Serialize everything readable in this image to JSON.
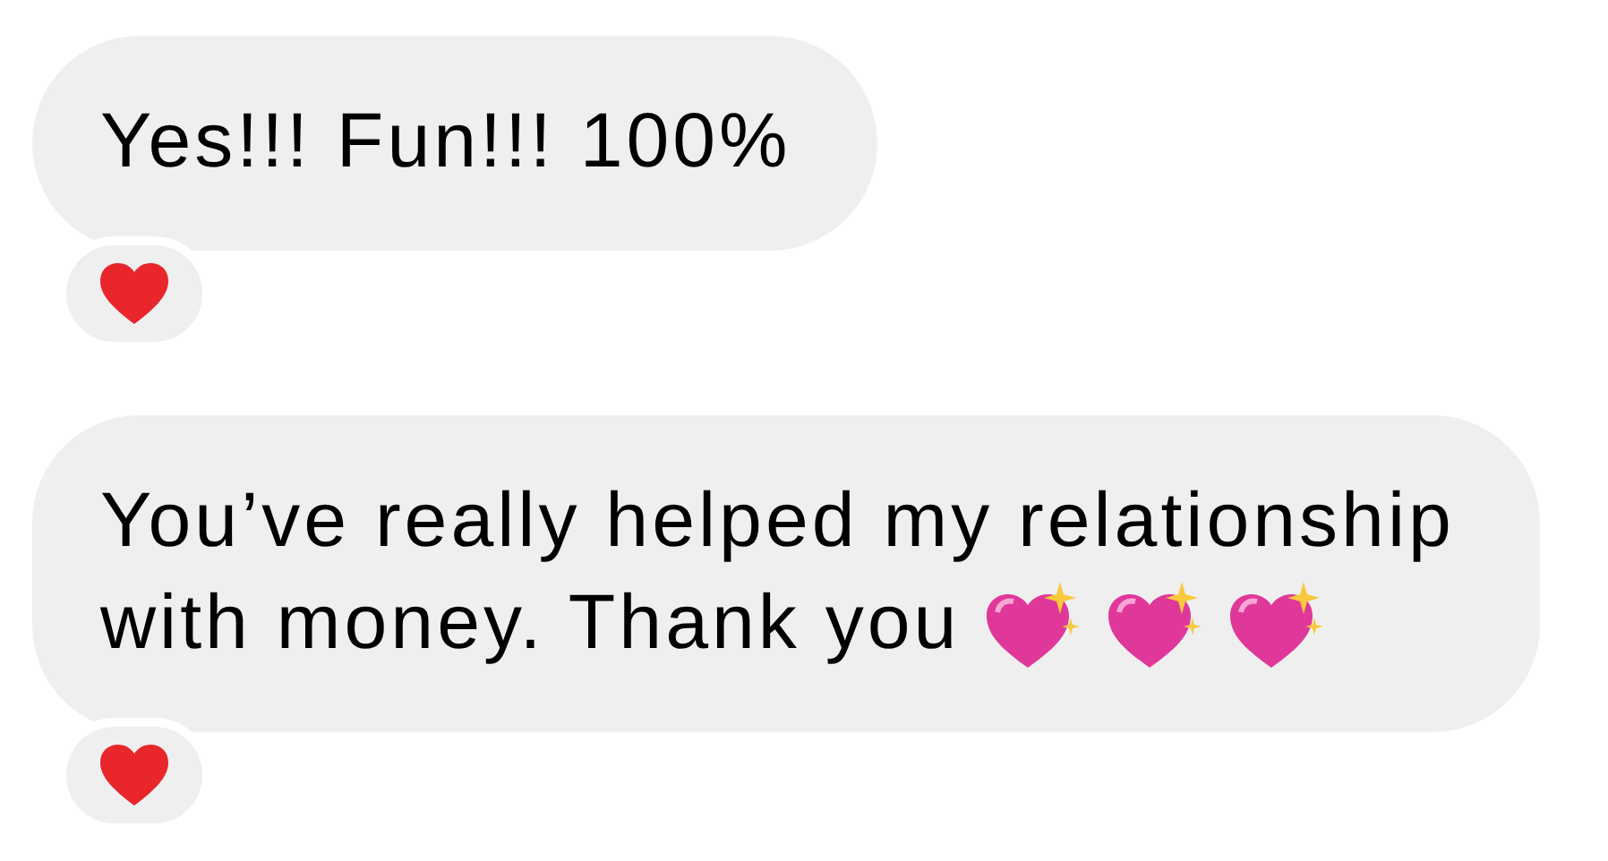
{
  "messages": [
    {
      "lines": [
        "Yes!!! Fun!!! 100%"
      ],
      "reaction": {
        "kind": "heart"
      }
    },
    {
      "lines": [
        "You’ve really helped my relationship",
        "with money. Thank you"
      ],
      "emojis": [
        {
          "kind": "sparkle-heart"
        },
        {
          "kind": "sparkle-heart"
        },
        {
          "kind": "sparkle-heart"
        }
      ],
      "reaction": {
        "kind": "heart"
      }
    }
  ]
}
